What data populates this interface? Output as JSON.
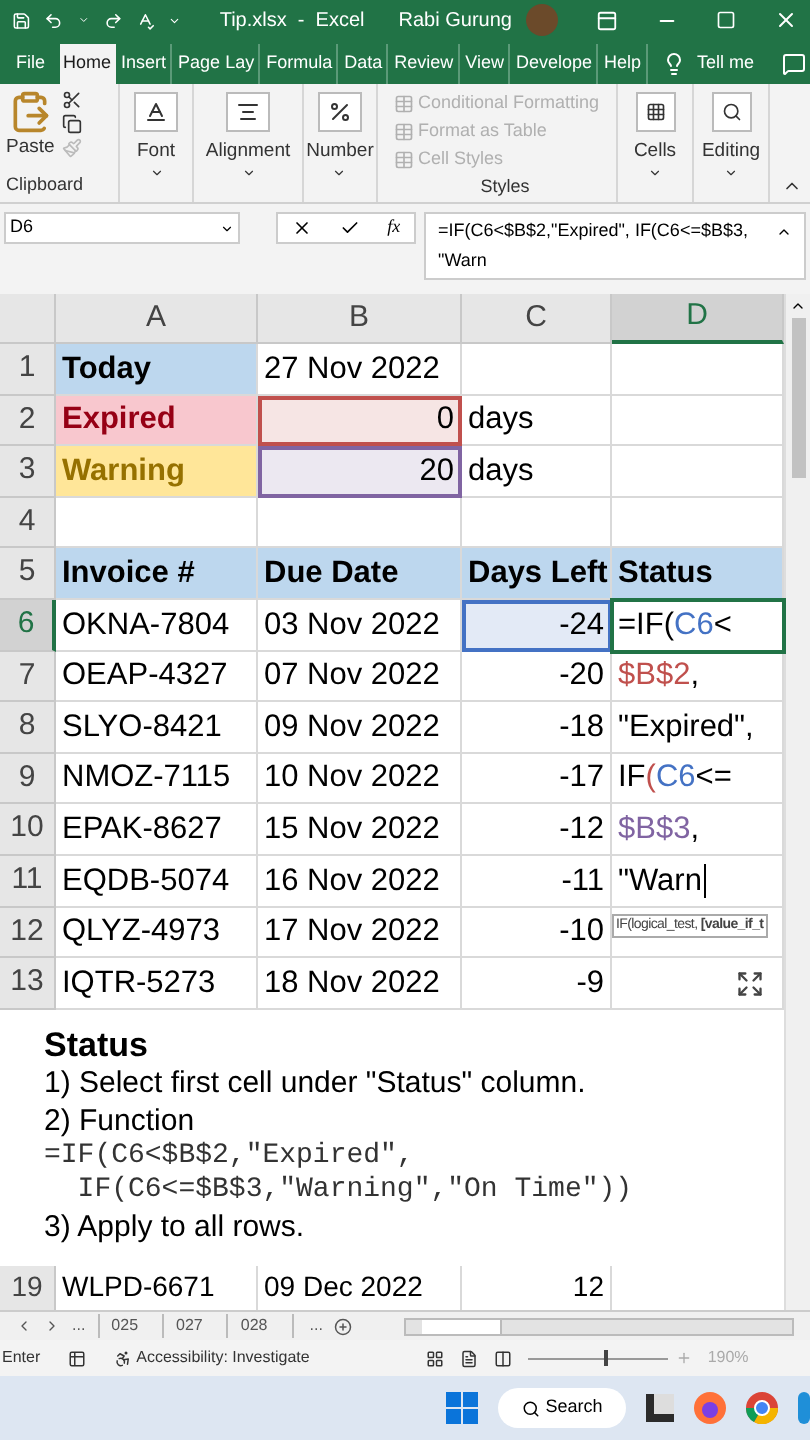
{
  "title_bar": {
    "file_title": "Tip.xlsx  -  Excel",
    "user": "Rabi Gurung"
  },
  "ribbon_tabs": [
    {
      "label": "File",
      "selected": false
    },
    {
      "label": "Home",
      "selected": true
    },
    {
      "label": "Insert",
      "selected": false
    },
    {
      "label": "Page Lay",
      "selected": false
    },
    {
      "label": "Formula",
      "selected": false
    },
    {
      "label": "Data",
      "selected": false
    },
    {
      "label": "Review",
      "selected": false
    },
    {
      "label": "View",
      "selected": false
    },
    {
      "label": "Develope",
      "selected": false
    },
    {
      "label": "Help",
      "selected": false
    }
  ],
  "tell_me": "Tell me",
  "ribbon": {
    "paste": "Paste",
    "clipboard": "Clipboard",
    "font": "Font",
    "alignment": "Alignment",
    "number": "Number",
    "styles_items": [
      {
        "label": "Conditional Formatting",
        "disabled": true
      },
      {
        "label": "Format as Table",
        "disabled": true
      },
      {
        "label": "Cell Styles",
        "disabled": true
      }
    ],
    "styles": "Styles",
    "cells": "Cells",
    "editing": "Editing"
  },
  "formula_bar": {
    "name_box": "D6",
    "function_label": "fx",
    "formula_lines": [
      "=IF(C6<$B$2,\"Expired\", IF(C6<=$B$3,",
      "\"Warn"
    ]
  },
  "columns": [
    {
      "label": "A",
      "selected": false
    },
    {
      "label": "B",
      "selected": false
    },
    {
      "label": "C",
      "selected": false
    },
    {
      "label": "D",
      "selected": true
    }
  ],
  "rows": [
    {
      "number": "1",
      "selected": false,
      "cells": [
        {
          "text": "Today",
          "kind": "label",
          "color": "#bdd7ee"
        },
        {
          "text": "27 Nov 2022"
        },
        null,
        null
      ]
    },
    {
      "number": "2",
      "selected": false,
      "cells": [
        {
          "text": "Expired",
          "kind": "label",
          "color": "#f8c7ce"
        },
        {
          "text": "0",
          "kind": "reference",
          "color": "#c0504d"
        },
        {
          "text": "days"
        },
        null
      ]
    },
    {
      "number": "3",
      "selected": false,
      "cells": [
        {
          "text": "Warning",
          "kind": "label",
          "color": "#ffe699"
        },
        {
          "text": "20",
          "kind": "reference",
          "color": "#8064a2"
        },
        {
          "text": "days"
        },
        null
      ]
    },
    {
      "number": "4",
      "selected": false,
      "cells": [
        null,
        null,
        null,
        null
      ]
    },
    {
      "number": "5",
      "selected": false,
      "cells": [
        {
          "text": "Invoice #",
          "kind": "header"
        },
        {
          "text": "Due Date",
          "kind": "header"
        },
        {
          "text": "Days Left",
          "kind": "header"
        },
        {
          "text": "Status",
          "kind": "header"
        }
      ]
    },
    {
      "number": "6",
      "selected": true,
      "cells": [
        {
          "text": "OKNA-7804"
        },
        {
          "text": "03 Nov 2022"
        },
        {
          "text": "-24",
          "kind": "reference",
          "color": "#4472c4"
        },
        {
          "caret": false,
          "parts": [
            {
              "text": "=IF(",
              "color": "#000000"
            },
            {
              "text": "C6",
              "color": "#4472c4"
            },
            {
              "text": "<",
              "color": "#000000"
            }
          ]
        }
      ]
    },
    {
      "number": "7",
      "selected": false,
      "cells": [
        {
          "text": "OEAP-4327"
        },
        {
          "text": "07 Nov 2022"
        },
        {
          "text": "-20",
          "kind": "number"
        },
        {
          "caret": false,
          "parts": [
            {
              "text": "$B$2",
              "color": "#c0504d"
            },
            {
              "text": ",",
              "color": "#000000"
            }
          ]
        }
      ]
    },
    {
      "number": "8",
      "selected": false,
      "cells": [
        {
          "text": "SLYO-8421"
        },
        {
          "text": "09 Nov 2022"
        },
        {
          "text": "-18",
          "kind": "number"
        },
        {
          "caret": false,
          "parts": [
            {
              "text": "\"Expired\",",
              "color": "#000000"
            }
          ]
        }
      ]
    },
    {
      "number": "9",
      "selected": false,
      "cells": [
        {
          "text": "NMOZ-7115"
        },
        {
          "text": "10 Nov 2022"
        },
        {
          "text": "-17",
          "kind": "number"
        },
        {
          "caret": false,
          "parts": [
            {
              "text": "IF",
              "color": "#000000"
            },
            {
              "text": "(",
              "color": "#c0504d"
            },
            {
              "text": "C6",
              "color": "#4472c4"
            },
            {
              "text": "<=",
              "color": "#000000"
            }
          ]
        }
      ]
    },
    {
      "number": "10",
      "selected": false,
      "cells": [
        {
          "text": "EPAK-8627"
        },
        {
          "text": "15 Nov 2022"
        },
        {
          "text": "-12",
          "kind": "number"
        },
        {
          "caret": false,
          "parts": [
            {
              "text": "$B$3",
              "color": "#8064a2"
            },
            {
              "text": ",",
              "color": "#000000"
            }
          ]
        }
      ]
    },
    {
      "number": "11",
      "selected": false,
      "cells": [
        {
          "text": "EQDB-5074"
        },
        {
          "text": "16 Nov 2022"
        },
        {
          "text": "-11",
          "kind": "number"
        },
        {
          "caret": true,
          "parts": [
            {
              "text": "\"Warn",
              "color": "#000000"
            }
          ]
        }
      ]
    },
    {
      "number": "12",
      "selected": false,
      "cells": [
        {
          "text": "QLYZ-4973"
        },
        {
          "text": "17 Nov 2022"
        },
        {
          "text": "-10",
          "kind": "number"
        },
        null
      ]
    },
    {
      "number": "13",
      "selected": false,
      "cells": [
        {
          "text": "IQTR-5273"
        },
        {
          "text": "18 Nov 2022"
        },
        {
          "text": "-9",
          "kind": "number"
        },
        null
      ]
    }
  ],
  "tooltip": "IF(logical_test, **[value_if_t**",
  "note": {
    "title": "Status",
    "lines": [
      {
        "kind": "text",
        "text": "1) Select first cell under \"Status\" column."
      },
      {
        "kind": "text",
        "text": "2) Function"
      },
      {
        "kind": "code",
        "text": "=IF(C6<$B$2,\"Expired\","
      },
      {
        "kind": "code",
        "text": "  IF(C6<=$B$3,\"Warning\",\"On Time\"))"
      },
      {
        "kind": "text",
        "text": "3) Apply to all rows."
      }
    ]
  },
  "last_row": {
    "number": "19",
    "cells": [
      "WLPD-6671",
      "09 Dec 2022",
      "12"
    ]
  },
  "sheet_tabs": {
    "more": "...",
    "tabs": [
      "025",
      "027",
      "028"
    ],
    "more_right": "..."
  },
  "status_bar": {
    "mode": "Enter",
    "accessibility": "Accessibility: Investigate",
    "zoom": "190%",
    "level": 0.55
  },
  "taskbar": {
    "search": "Search"
  }
}
